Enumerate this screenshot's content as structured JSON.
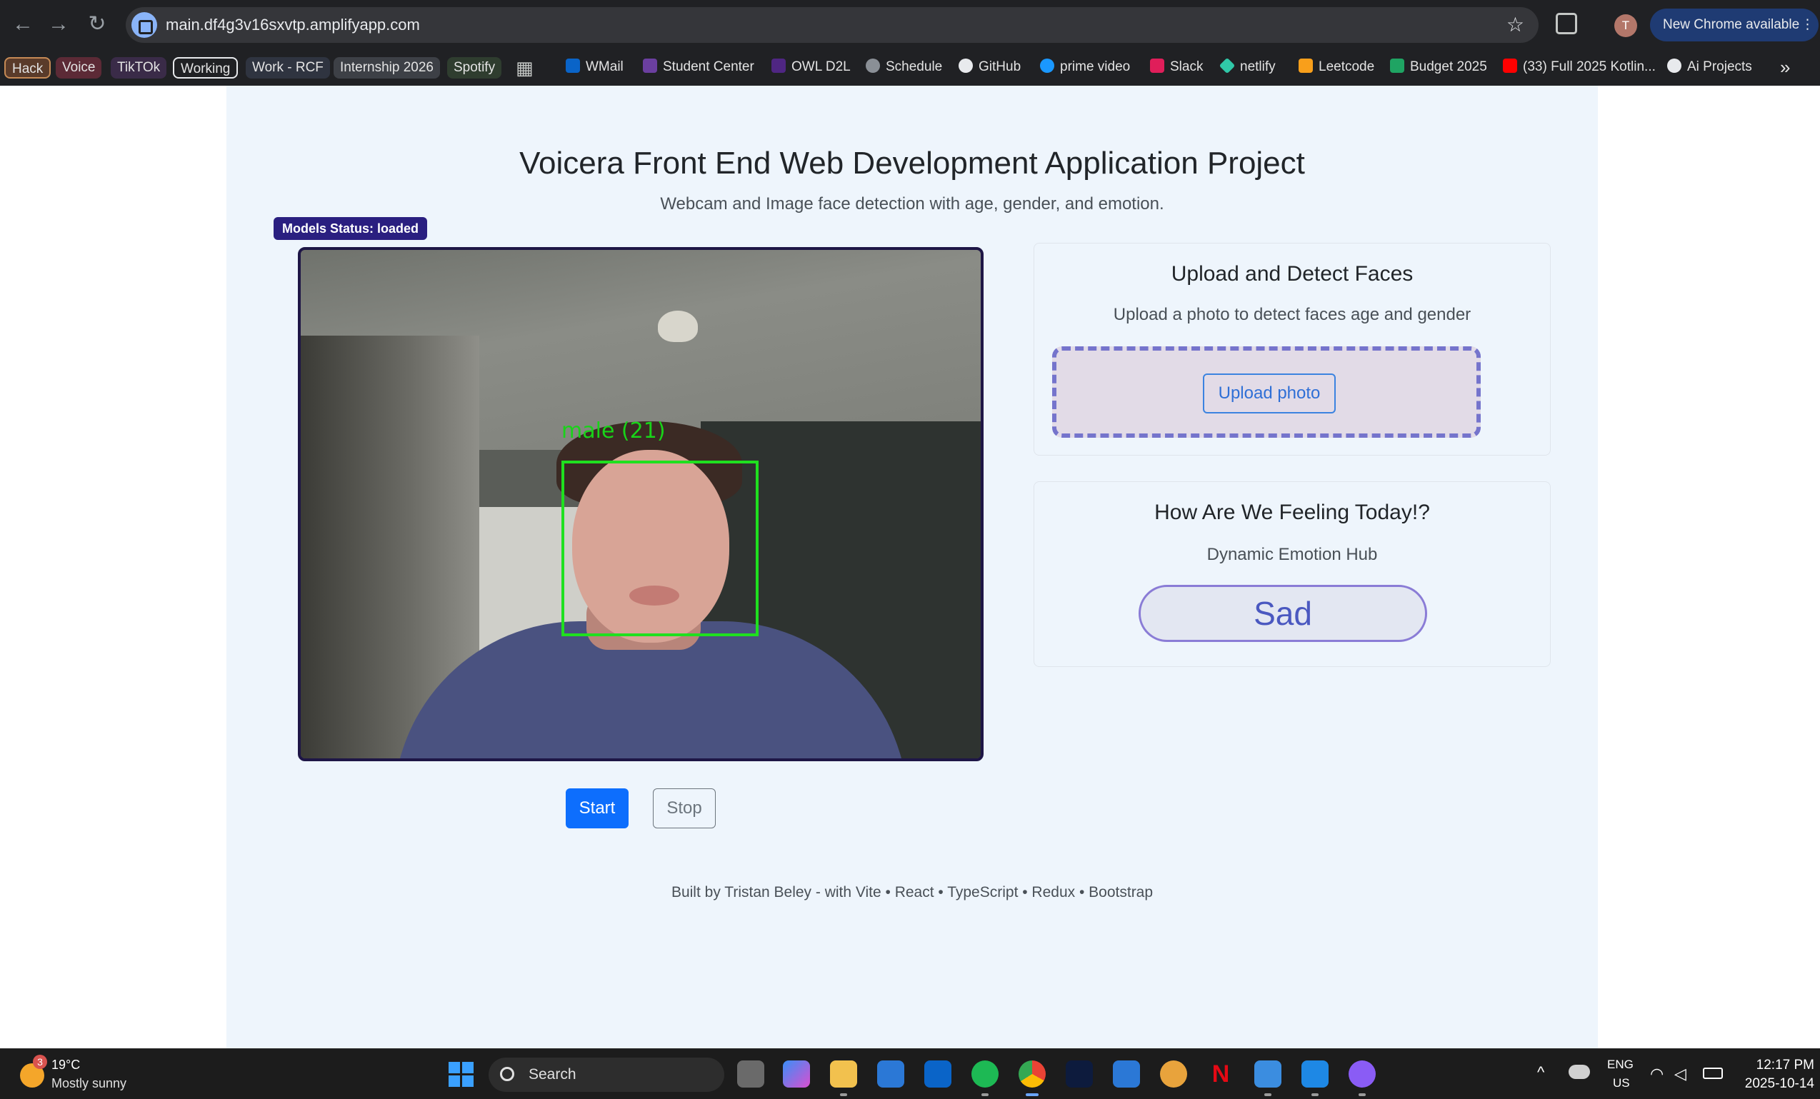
{
  "browser": {
    "url": "main.df4g3v16sxvtp.amplifyapp.com",
    "profile_initial": "T",
    "new_chrome_label": "New Chrome available",
    "overflow_label": "»"
  },
  "bookmarks": [
    {
      "label": "Hack"
    },
    {
      "label": "Voice"
    },
    {
      "label": "TikTOk"
    },
    {
      "label": "Working"
    },
    {
      "label": "Work - RCF"
    },
    {
      "label": "Internship 2026"
    },
    {
      "label": "Spotify"
    },
    {
      "label": "WMail"
    },
    {
      "label": "Student Center"
    },
    {
      "label": "OWL D2L"
    },
    {
      "label": "Schedule"
    },
    {
      "label": "GitHub"
    },
    {
      "label": "prime video"
    },
    {
      "label": "Slack"
    },
    {
      "label": "netlify"
    },
    {
      "label": "Leetcode"
    },
    {
      "label": "Budget 2025"
    },
    {
      "label": "(33) Full 2025 Kotlin..."
    },
    {
      "label": "Ai Projects"
    }
  ],
  "page": {
    "title": "Voicera Front End Web Development Application Project",
    "subtitle": "Webcam and Image face detection with age, gender, and emotion.",
    "models_status": "Models Status: loaded",
    "detection_label": "male (21)",
    "start_label": "Start",
    "stop_label": "Stop",
    "upload_card": {
      "title": "Upload and Detect Faces",
      "text": "Upload a photo to detect faces age and gender",
      "button": "Upload photo"
    },
    "emotion_card": {
      "title": "How Are We Feeling Today!?",
      "subtitle": "Dynamic Emotion Hub",
      "emotion": "Sad"
    },
    "footer": "Built by Tristan Beley - with Vite • React • TypeScript • Redux • Bootstrap"
  },
  "taskbar": {
    "weather_badge": "3",
    "temperature": "19°C",
    "weather": "Mostly sunny",
    "search_placeholder": "Search",
    "language": "ENG",
    "region": "US",
    "time": "12:17 PM",
    "date": "2025-10-14"
  },
  "colors": {
    "accent": "#0d6efd",
    "badge": "#2a1f80",
    "detection_box": "#1fe01f",
    "emotion_text": "#4a58c0"
  }
}
